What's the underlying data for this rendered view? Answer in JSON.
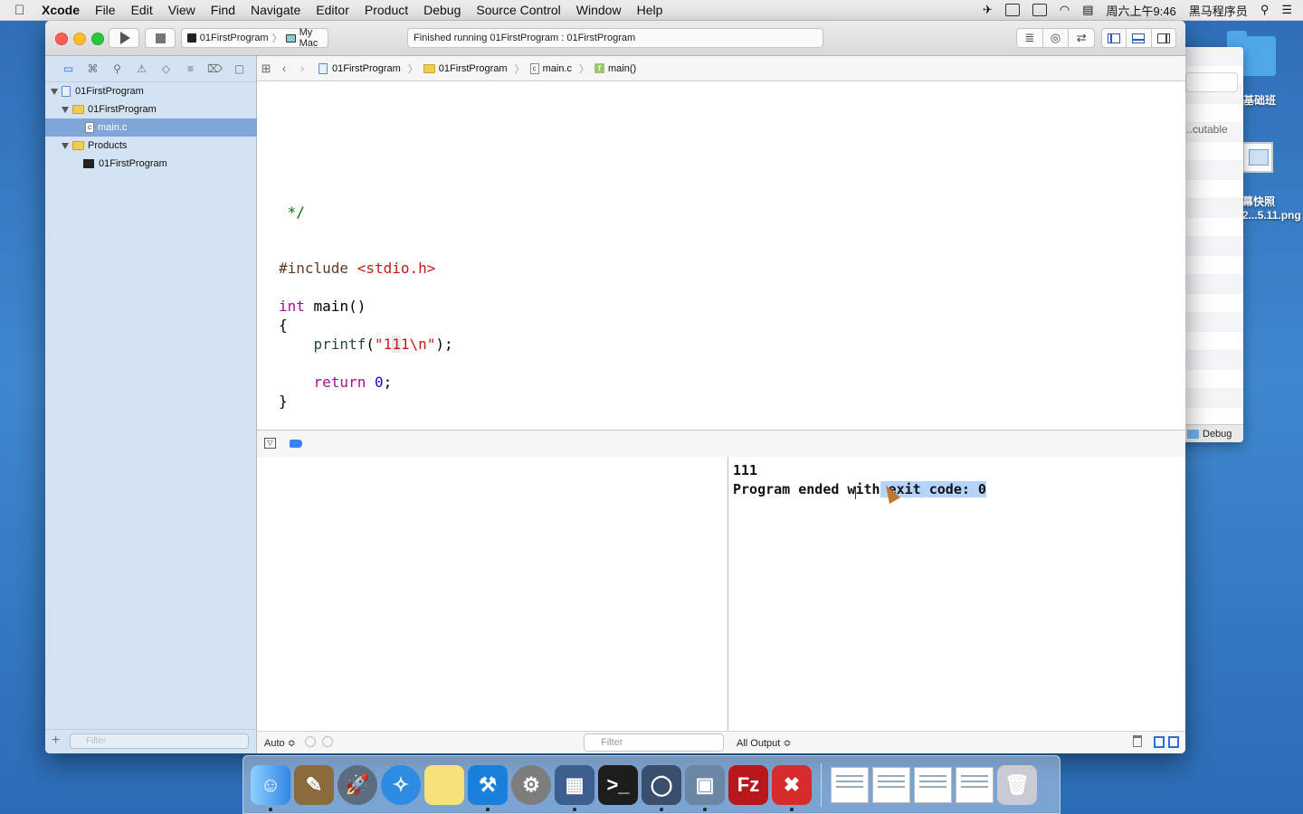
{
  "menubar": {
    "app": "Xcode",
    "items": [
      "File",
      "Edit",
      "View",
      "Find",
      "Navigate",
      "Editor",
      "Product",
      "Debug",
      "Source Control",
      "Window",
      "Help"
    ],
    "clock": "周六上午9:46",
    "user": "黑马程序员"
  },
  "desktop": {
    "folder_label": "基础班",
    "screenshot_label1": "幕快照",
    "screenshot_label2": "2...5.11.png"
  },
  "finder": {
    "exec_label": "...cutable",
    "bottom_label": "Debug"
  },
  "toolbar": {
    "scheme": "01FirstProgram",
    "destination": "My Mac",
    "status": "Finished running 01FirstProgram : 01FirstProgram"
  },
  "navigator": {
    "tree": [
      {
        "label": "01FirstProgram"
      },
      {
        "label": "01FirstProgram"
      },
      {
        "label": "main.c"
      },
      {
        "label": "Products"
      },
      {
        "label": "01FirstProgram"
      }
    ],
    "filter_placeholder": "Filter"
  },
  "jumpbar": {
    "crumbs": [
      "01FirstProgram",
      "01FirstProgram",
      "main.c",
      "main()"
    ]
  },
  "editor": {
    "lines": {
      "comment_end": " */",
      "include_kw": "#include",
      "include_file": "<stdio.h>",
      "int_kw": "int",
      "main_sig": " main()",
      "open_brace": "{",
      "printf_fn": "    printf",
      "printf_open": "(",
      "str_a": "\"1",
      "str_cursor": "1",
      "str_b": "1\\n\"",
      "printf_close": ");",
      "return_kw": "    return",
      "return_val": "0",
      "semicolon": ";",
      "close_brace": "}"
    }
  },
  "debug": {
    "auto_label": "Auto ≎",
    "filter_placeholder": "Filter",
    "output_label": "All Output ≎",
    "console": {
      "line1": "111",
      "line2_plain": "Program ended with",
      "line2_selected": " exit code: 0"
    }
  }
}
